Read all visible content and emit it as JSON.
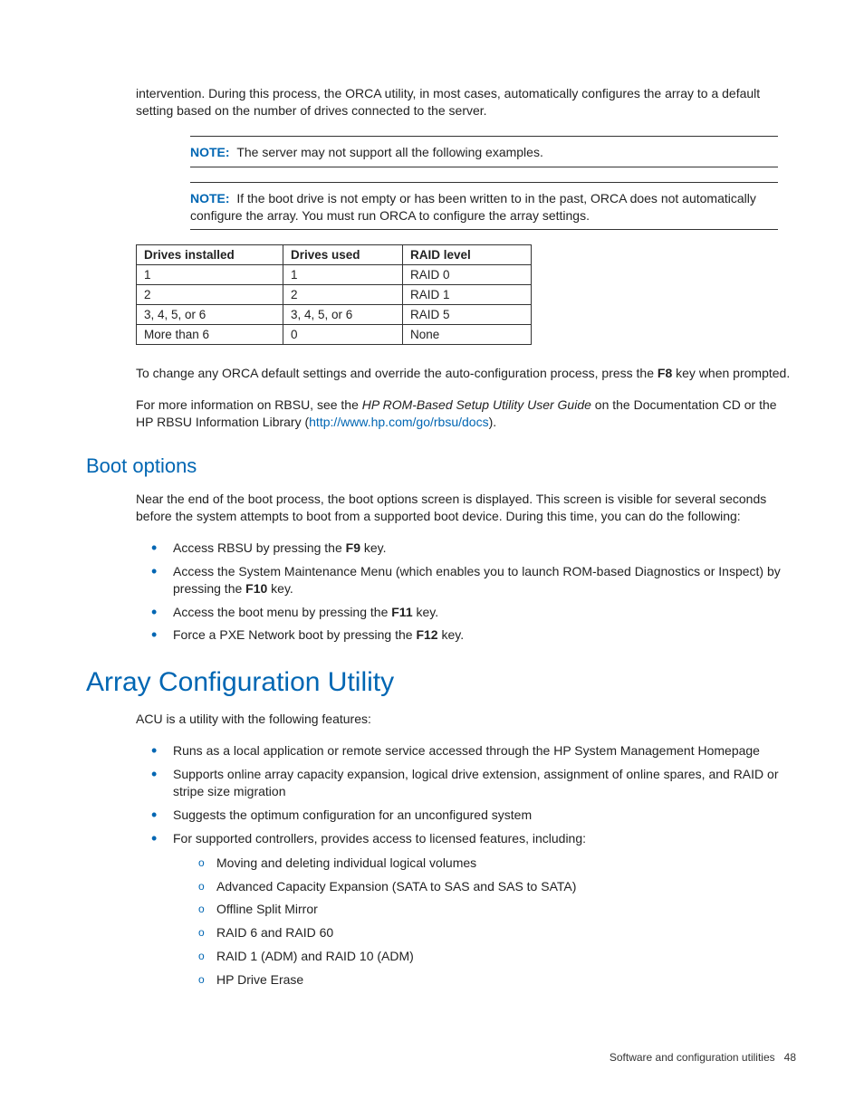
{
  "intro": "intervention. During this process, the ORCA utility, in most cases, automatically configures the array to a default setting based on the number of drives connected to the server.",
  "notes": {
    "label": "NOTE:",
    "note1": "The server may not support all the following examples.",
    "note2": "If the boot drive is not empty or has been written to in the past, ORCA does not automatically configure the array. You must run ORCA to configure the array settings."
  },
  "table": {
    "headers": [
      "Drives installed",
      "Drives used",
      "RAID level"
    ],
    "rows": [
      [
        "1",
        "1",
        "RAID 0"
      ],
      [
        "2",
        "2",
        "RAID 1"
      ],
      [
        "3, 4, 5, or 6",
        "3, 4, 5, or 6",
        "RAID 5"
      ],
      [
        "More than 6",
        "0",
        "None"
      ]
    ]
  },
  "para_change_pre": "To change any ORCA default settings and override the auto-configuration process, press the ",
  "para_change_key": "F8",
  "para_change_post": " key when prompted.",
  "para_info_pre": "For more information on RBSU, see the ",
  "para_info_italic": "HP ROM-Based Setup Utility User Guide",
  "para_info_mid": " on the Documentation CD or the HP RBSU Information Library (",
  "para_info_link": "http://www.hp.com/go/rbsu/docs",
  "para_info_post": ").",
  "boot": {
    "heading": "Boot options",
    "intro": "Near the end of the boot process, the boot options screen is displayed. This screen is visible for several seconds before the system attempts to boot from a supported boot device. During this time, you can do the following:",
    "item1_pre": "Access RBSU by pressing the ",
    "item1_key": "F9",
    "item1_post": " key.",
    "item2_pre": "Access the System Maintenance Menu (which enables you to launch ROM-based Diagnostics or Inspect) by pressing the ",
    "item2_key": "F10",
    "item2_post": " key.",
    "item3_pre": "Access the boot menu by pressing the ",
    "item3_key": "F11",
    "item3_post": " key.",
    "item4_pre": "Force a PXE Network boot by pressing the ",
    "item4_key": "F12",
    "item4_post": " key."
  },
  "acu": {
    "heading": "Array Configuration Utility",
    "intro": "ACU is a utility with the following features:",
    "b1": "Runs as a local application or remote service accessed through the HP System Management Homepage",
    "b2": "Supports online array capacity expansion, logical drive extension, assignment of online spares, and RAID or stripe size migration",
    "b3": "Suggests the optimum configuration for an unconfigured system",
    "b4": "For supported controllers, provides access to licensed features, including:",
    "s1": "Moving and deleting individual logical volumes",
    "s2": "Advanced Capacity Expansion (SATA to SAS and SAS to SATA)",
    "s3": "Offline Split Mirror",
    "s4": "RAID 6 and RAID 60",
    "s5": "RAID 1 (ADM) and RAID 10 (ADM)",
    "s6": "HP Drive Erase"
  },
  "footer": {
    "text": "Software and configuration utilities",
    "page": "48"
  }
}
